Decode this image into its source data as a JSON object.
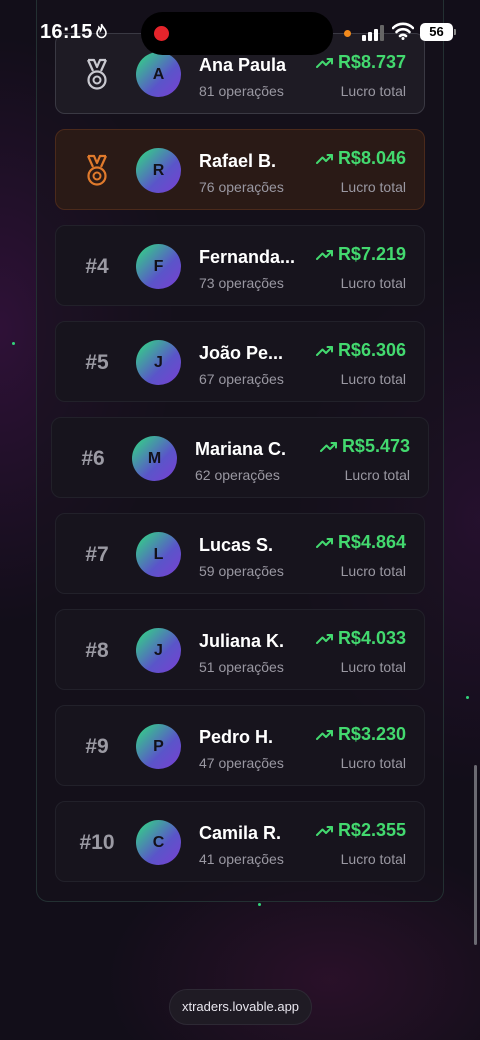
{
  "status_bar": {
    "time": "16:15",
    "battery": "56"
  },
  "ranking": [
    {
      "rank": "",
      "medal": "silver-medal-icon",
      "initial": "A",
      "name": "Ana Paula",
      "operations": "81 operações",
      "profit": "R$8.737",
      "profit_label": "Lucro total"
    },
    {
      "rank": "",
      "medal": "bronze-medal-icon",
      "initial": "R",
      "name": "Rafael B.",
      "operations": "76 operações",
      "profit": "R$8.046",
      "profit_label": "Lucro total"
    },
    {
      "rank": "#4",
      "initial": "F",
      "name": "Fernanda...",
      "operations": "73 operações",
      "profit": "R$7.219",
      "profit_label": "Lucro total"
    },
    {
      "rank": "#5",
      "initial": "J",
      "name": "João Pe...",
      "operations": "67 operações",
      "profit": "R$6.306",
      "profit_label": "Lucro total"
    },
    {
      "rank": "#6",
      "initial": "M",
      "name": "Mariana C.",
      "operations": "62 operações",
      "profit": "R$5.473",
      "profit_label": "Lucro total"
    },
    {
      "rank": "#7",
      "initial": "L",
      "name": "Lucas S.",
      "operations": "59 operações",
      "profit": "R$4.864",
      "profit_label": "Lucro total"
    },
    {
      "rank": "#8",
      "initial": "J",
      "name": "Juliana K.",
      "operations": "51 operações",
      "profit": "R$4.033",
      "profit_label": "Lucro total"
    },
    {
      "rank": "#9",
      "initial": "P",
      "name": "Pedro H.",
      "operations": "47 operações",
      "profit": "R$3.230",
      "profit_label": "Lucro total"
    },
    {
      "rank": "#10",
      "initial": "C",
      "name": "Camila R.",
      "operations": "41 operações",
      "profit": "R$2.355",
      "profit_label": "Lucro total"
    }
  ],
  "browser": {
    "url": "xtraders.lovable.app"
  },
  "colors": {
    "profit": "#43d96f",
    "silver_medal": "#c9c9d0",
    "bronze_medal": "#e07a2c"
  }
}
